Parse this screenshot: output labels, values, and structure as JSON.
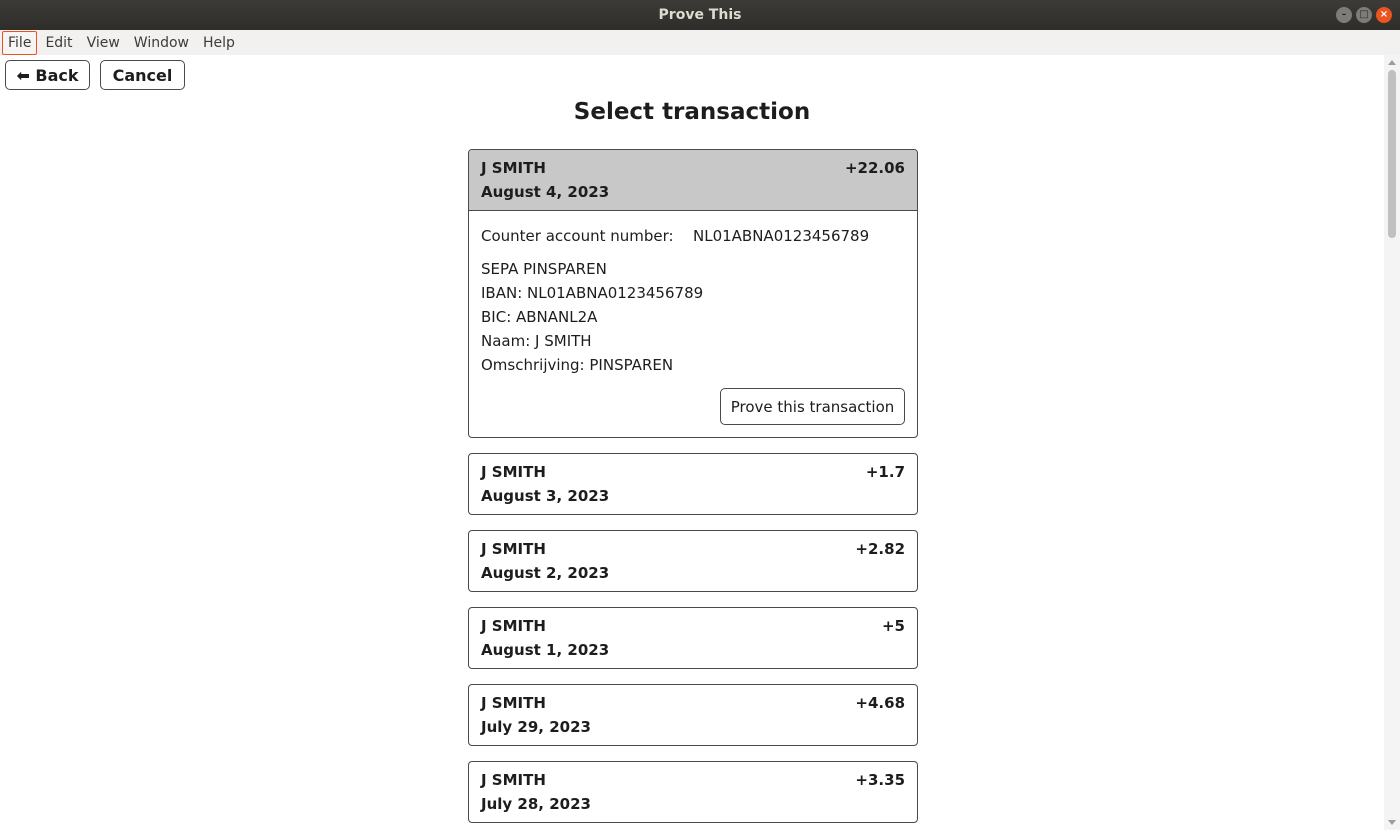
{
  "window": {
    "title": "Prove This",
    "controls": {
      "minimize": "–",
      "maximize": "□",
      "close": "×"
    }
  },
  "menubar": {
    "items": [
      "File",
      "Edit",
      "View",
      "Window",
      "Help"
    ]
  },
  "toolbar": {
    "back_label": "⬅ Back",
    "cancel_label": "Cancel"
  },
  "page": {
    "title": "Select transaction"
  },
  "transactions": [
    {
      "name": "J SMITH",
      "date": "August 4, 2023",
      "amount": "+22.06",
      "expanded": true,
      "counter_label": "Counter account number:",
      "counter_value": "NL01ABNA0123456789",
      "description": [
        "SEPA PINSPAREN",
        "IBAN: NL01ABNA0123456789",
        "BIC: ABNANL2A",
        "Naam: J SMITH",
        "Omschrijving: PINSPAREN"
      ],
      "prove_label": "Prove this transaction"
    },
    {
      "name": "J SMITH",
      "date": "August 3, 2023",
      "amount": "+1.7"
    },
    {
      "name": "J SMITH",
      "date": "August 2, 2023",
      "amount": "+2.82"
    },
    {
      "name": "J SMITH",
      "date": "August 1, 2023",
      "amount": "+5"
    },
    {
      "name": "J SMITH",
      "date": "July 29, 2023",
      "amount": "+4.68"
    },
    {
      "name": "J SMITH",
      "date": "July 28, 2023",
      "amount": "+3.35"
    }
  ],
  "colors": {
    "titlebar": "#2e2d29",
    "accent": "#e95420",
    "expanded_header": "#c8c8c8",
    "border": "#4a4a4a"
  }
}
